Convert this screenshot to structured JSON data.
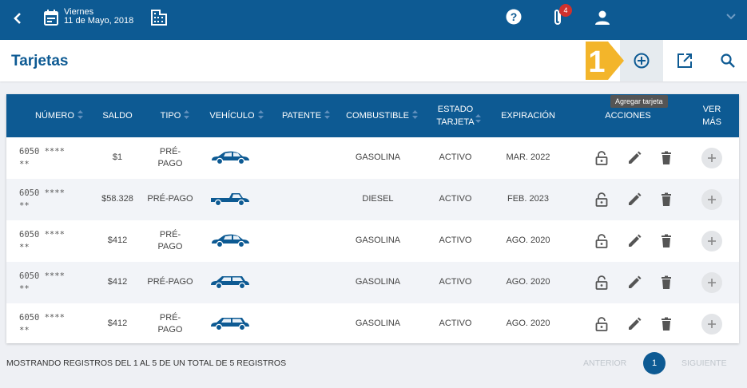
{
  "header": {
    "day_name": "Viernes",
    "date": "11 de Mayo, 2018",
    "notification_count": "4"
  },
  "page": {
    "title": "Tarjetas",
    "tooltip": "Agregar tarjeta",
    "callout_number": "1"
  },
  "table": {
    "columns": {
      "numero": "NÚMERO",
      "saldo": "SALDO",
      "tipo": "TIPO",
      "vehiculo": "VEHÍCULO",
      "patente": "PATENTE",
      "combustible": "COMBUSTIBLE",
      "estado_l1": "ESTADO",
      "estado_l2": "TARJETA",
      "expiracion": "EXPIRACIÓN",
      "acciones": "ACCIONES",
      "vermas_l1": "VER",
      "vermas_l2": "MÁS"
    },
    "rows": [
      {
        "num_l1": "6050 ****",
        "num_l2": "**",
        "saldo": "$1",
        "tipo_l1": "PRÉ-",
        "tipo_l2": "PAGO",
        "vehicle_icon": "sedan-icon",
        "patente": "",
        "combustible": "GASOLINA",
        "estado": "ACTIVO",
        "expiracion": "MAR. 2022"
      },
      {
        "num_l1": "6050 ****",
        "num_l2": "**",
        "saldo": "$58.328",
        "tipo_l1": "PRÉ-PAGO",
        "tipo_l2": "",
        "vehicle_icon": "pickup-icon",
        "patente": "",
        "combustible": "DIESEL",
        "estado": "ACTIVO",
        "expiracion": "FEB. 2023"
      },
      {
        "num_l1": "6050 ****",
        "num_l2": "**",
        "saldo": "$412",
        "tipo_l1": "PRÉ-",
        "tipo_l2": "PAGO",
        "vehicle_icon": "sedan-icon",
        "patente": "",
        "combustible": "GASOLINA",
        "estado": "ACTIVO",
        "expiracion": "AGO. 2020"
      },
      {
        "num_l1": "6050 ****",
        "num_l2": "**",
        "saldo": "$412",
        "tipo_l1": "PRÉ-PAGO",
        "tipo_l2": "",
        "vehicle_icon": "wagon-icon",
        "patente": "",
        "combustible": "GASOLINA",
        "estado": "ACTIVO",
        "expiracion": "AGO. 2020"
      },
      {
        "num_l1": "6050 ****",
        "num_l2": "**",
        "saldo": "$412",
        "tipo_l1": "PRÉ-",
        "tipo_l2": "PAGO",
        "vehicle_icon": "wagon-icon",
        "patente": "",
        "combustible": "GASOLINA",
        "estado": "ACTIVO",
        "expiracion": "AGO. 2020"
      }
    ]
  },
  "footer": {
    "info": "MOSTRANDO REGISTROS DEL 1 AL 5 DE UN TOTAL DE 5 REGISTROS",
    "prev": "ANTERIOR",
    "current_page": "1",
    "next": "SIGUIENTE"
  },
  "colors": {
    "primary": "#0d5a93",
    "callout": "#f3b52a",
    "badge": "#d0312d"
  }
}
